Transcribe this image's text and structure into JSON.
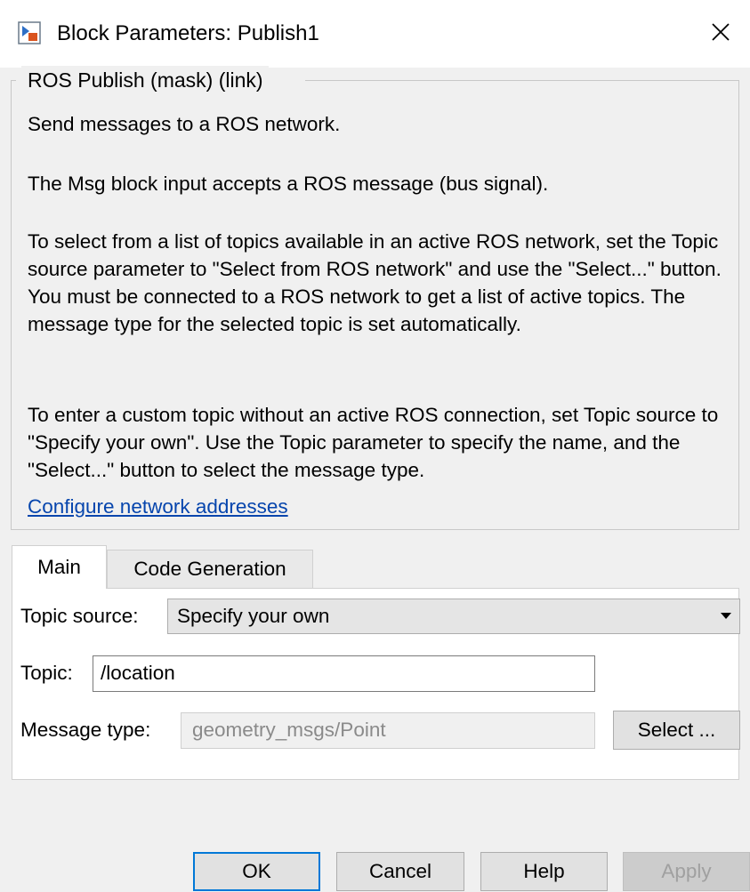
{
  "window": {
    "title": "Block Parameters: Publish1",
    "close_icon": "close-icon",
    "app_icon": "simulink-block-icon"
  },
  "description": {
    "group_title": "ROS Publish (mask) (link)",
    "paragraphs": [
      "Send messages to a ROS network.",
      "The Msg block input accepts a ROS message (bus signal).",
      "To select from a list of topics available in an active ROS network, set the Topic source parameter to \"Select from ROS network\" and use the \"Select...\" button. You must be connected to a ROS network to get a list of active topics. The message type for the selected topic is set automatically.",
      "To enter a custom topic without an active ROS connection, set Topic source to \"Specify your own\". Use the Topic parameter to specify the name, and the \"Select...\" button to select the message type."
    ],
    "link": "Configure network addresses"
  },
  "tabs": [
    {
      "label": "Main",
      "selected": true
    },
    {
      "label": "Code Generation",
      "selected": false
    }
  ],
  "params": {
    "topic_source_label": "Topic source:",
    "topic_source_value": "Specify your own",
    "topic_label": "Topic:",
    "topic_value": "/location",
    "message_type_label": "Message type:",
    "message_type_value": "geometry_msgs/Point",
    "select_button": "Select ..."
  },
  "buttons": {
    "ok": "OK",
    "cancel": "Cancel",
    "help": "Help",
    "apply": "Apply"
  },
  "colors": {
    "link": "#0645ad",
    "focus_border": "#0078d7",
    "disabled_text": "#a0a0a0"
  }
}
